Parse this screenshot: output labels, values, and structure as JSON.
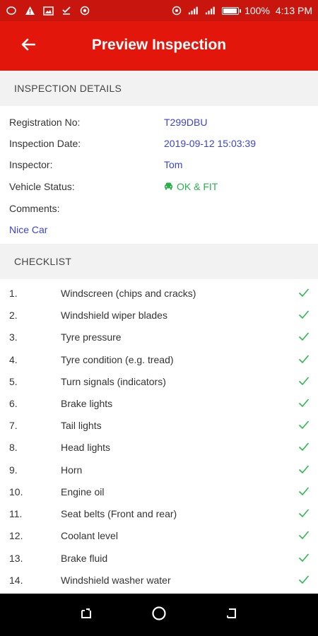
{
  "status_bar": {
    "battery_text": "100%",
    "time": "4:13 PM",
    "battery_level": 1.0
  },
  "header": {
    "title": "Preview Inspection"
  },
  "inspection_details": {
    "heading": "INSPECTION DETAILS",
    "registration_label": "Registration No:",
    "registration_value": "T299DBU",
    "date_label": "Inspection Date:",
    "date_value": "2019-09-12 15:03:39",
    "inspector_label": "Inspector:",
    "inspector_value": "Tom",
    "vehicle_status_label": "Vehicle Status:",
    "vehicle_status_value": "OK & FIT",
    "comments_label": "Comments:",
    "comments_value": "Nice Car"
  },
  "checklist": {
    "heading": "CHECKLIST",
    "items": [
      {
        "num": "1.",
        "label": "Windscreen (chips and cracks)"
      },
      {
        "num": "2.",
        "label": "Windshield wiper blades"
      },
      {
        "num": "3.",
        "label": "Tyre pressure"
      },
      {
        "num": "4.",
        "label": "Tyre condition (e.g. tread)"
      },
      {
        "num": "5.",
        "label": "Turn signals (indicators)"
      },
      {
        "num": "6.",
        "label": "Brake lights"
      },
      {
        "num": "7.",
        "label": "Tail lights"
      },
      {
        "num": "8.",
        "label": "Head lights"
      },
      {
        "num": "9.",
        "label": "Horn"
      },
      {
        "num": "10.",
        "label": "Engine oil"
      },
      {
        "num": "11.",
        "label": "Seat belts (Front and rear)"
      },
      {
        "num": "12.",
        "label": "Coolant level"
      },
      {
        "num": "13.",
        "label": "Brake fluid"
      },
      {
        "num": "14.",
        "label": "Windshield washer water"
      }
    ]
  },
  "colors": {
    "app_bar": "#e3160c",
    "status_bar": "#c8160f",
    "value_blue": "#3a44d1",
    "ok_green": "#28b04b",
    "check_green": "#2eb84f"
  },
  "icons": {
    "back": "arrow-left-icon",
    "vehicle_status": "car-icon",
    "checklist_item": "check-icon"
  }
}
